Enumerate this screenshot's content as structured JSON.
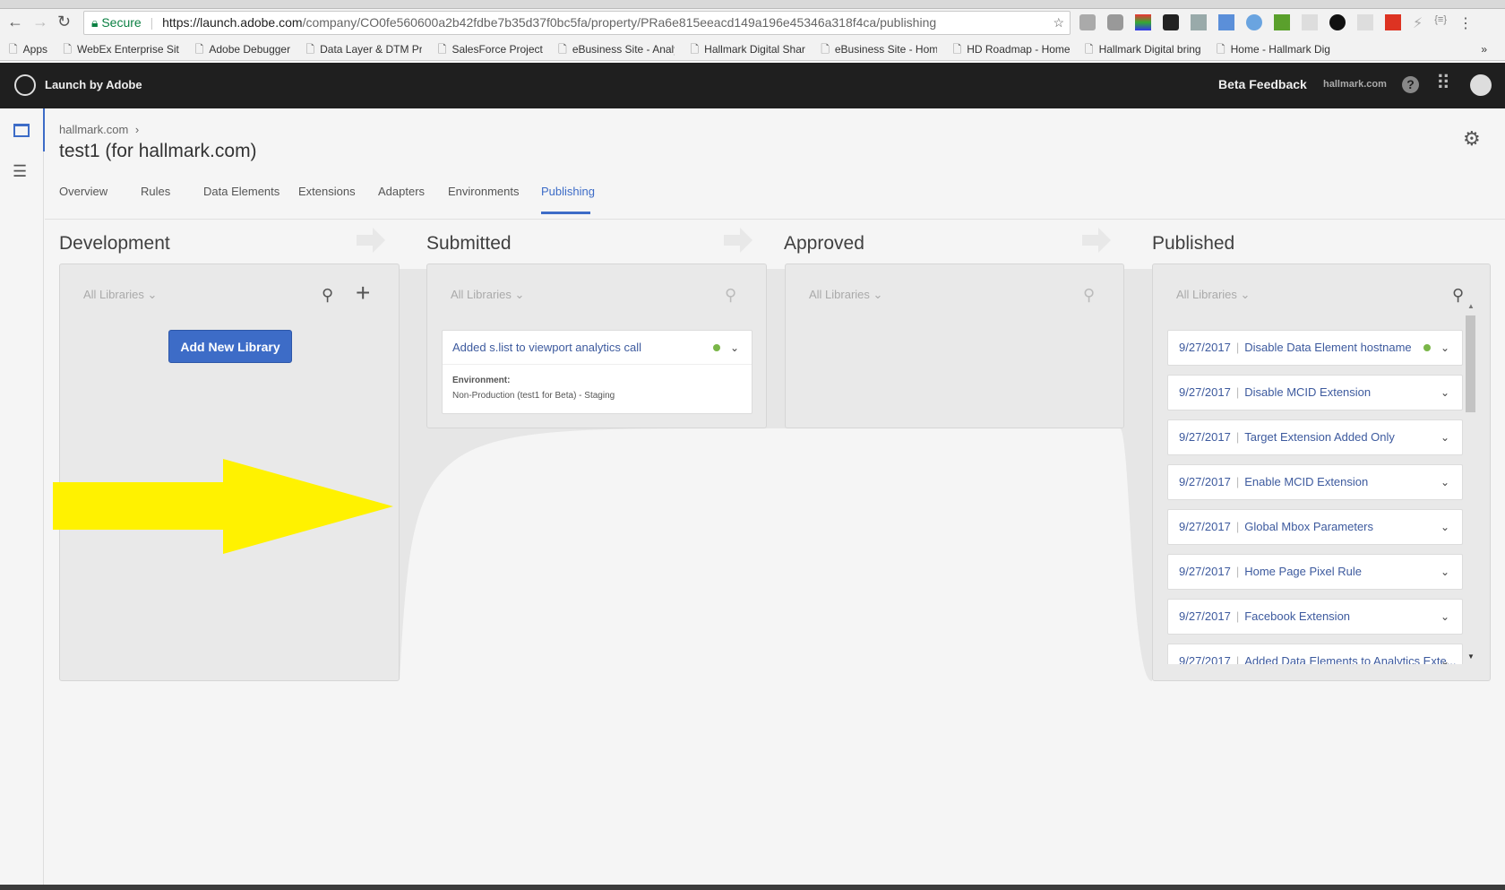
{
  "browser": {
    "secure_label": "Secure",
    "url_host": "https://launch.adobe.com",
    "url_rest": "/company/CO0fe560600a2b42fdbe7b35d37f0bc5fa/property/PRa6e815eeacd149a196e45346a318f4ca/publishing",
    "bookmarks": [
      "Apps",
      "WebEx Enterprise Site",
      "Adobe Debugger",
      "Data Layer & DTM Pr",
      "SalesForce Project",
      "eBusiness Site - Analy",
      "Hallmark Digital Shar",
      "eBusiness Site - Home",
      "HD Roadmap - Home",
      "Hallmark Digital bring",
      "Home - Hallmark Dig"
    ],
    "more": "»"
  },
  "header": {
    "app_name": "Launch by Adobe",
    "beta_feedback": "Beta Feedback",
    "company": "hallmark.com"
  },
  "breadcrumb": {
    "parent": "hallmark.com",
    "separator": "›"
  },
  "page_title": "test1 (for hallmark.com)",
  "tabs": [
    "Overview",
    "Rules",
    "Data Elements",
    "Extensions",
    "Adapters",
    "Environments",
    "Publishing"
  ],
  "active_tab": "Publishing",
  "columns": {
    "development": {
      "title": "Development",
      "filter": "All Libraries",
      "add_button": "Add New Library"
    },
    "submitted": {
      "title": "Submitted",
      "filter": "All Libraries",
      "card": {
        "name": "Added s.list to viewport analytics call",
        "env_label": "Environment:",
        "env_value": "Non-Production (test1 for Beta) - Staging"
      }
    },
    "approved": {
      "title": "Approved",
      "filter": "All Libraries"
    },
    "published": {
      "title": "Published",
      "filter": "All Libraries",
      "items": [
        {
          "date": "9/27/2017",
          "name": "Disable Data Element hostname",
          "active": true
        },
        {
          "date": "9/27/2017",
          "name": "Disable MCID Extension"
        },
        {
          "date": "9/27/2017",
          "name": "Target Extension Added Only"
        },
        {
          "date": "9/27/2017",
          "name": "Enable MCID Extension"
        },
        {
          "date": "9/27/2017",
          "name": "Global Mbox Parameters"
        },
        {
          "date": "9/27/2017",
          "name": "Home Page Pixel Rule"
        },
        {
          "date": "9/27/2017",
          "name": "Facebook Extension"
        },
        {
          "date": "9/27/2017",
          "name": "Added Data Elements to Analytics Exte..."
        }
      ]
    }
  },
  "colors": {
    "accent": "#3d6cc7",
    "link": "#3d5a9e",
    "status_green": "#7ab648",
    "annotation_arrow": "#fff200",
    "header_bg": "#1f1f1f"
  }
}
